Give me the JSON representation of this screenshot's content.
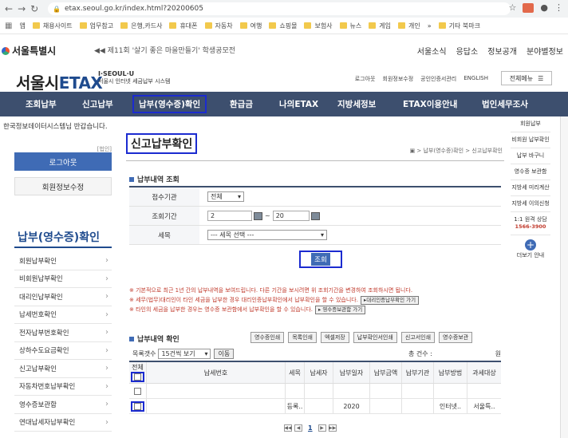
{
  "browser": {
    "url": "etax.seoul.go.kr/index.html?20200605",
    "bookmarks": [
      "앱",
      "채용사이트",
      "업무참고",
      "은행,카드사",
      "휴대폰",
      "자동차",
      "여행",
      "쇼핑몰",
      "보험사",
      "뉴스",
      "게임",
      "개인",
      "기타 북마크"
    ],
    "more": "»"
  },
  "seoul": {
    "logo": "서울특별시",
    "notice": "◀◀ 제11회 '살기 좋은 마을만들기' 학생공모전",
    "links": [
      "서울소식",
      "응답소",
      "정보공개",
      "분야별정보"
    ]
  },
  "etax": {
    "logo_a": "서울시",
    "logo_b": "ETAX",
    "sub1": "I·SEOUL·U",
    "sub2": "서울시 인터넷 세금납부 시스템",
    "utils": [
      "로그아웃",
      "회원정보수정",
      "공인인증서관리",
      "ENGLISH"
    ],
    "fullmenu": "전체메뉴"
  },
  "gnb": [
    "조회납부",
    "신고납부",
    "납부(영수증)확인",
    "환급금",
    "나의ETAX",
    "지방세정보",
    "ETAX이용안내",
    "법인세무조사"
  ],
  "left": {
    "user_line": "한국정보데이터시스템님 반갑습니다.",
    "user_tag": "[법인]",
    "logout": "로그아웃",
    "member": "회원정보수정",
    "title": "납부(영수증)확인",
    "menu": [
      "회원납부확인",
      "비회원납부확인",
      "대리인납부확인",
      "납세번호확인",
      "전자납부번호확인",
      "상하수도요금확인",
      "신고납부확인",
      "자동차번호납부확인",
      "영수증보관함",
      "연대납세자납부확인"
    ]
  },
  "main": {
    "title": "신고납부확인",
    "breadcrumb": "▣ > 납부(영수증)확인 > 신고납부확인",
    "search_head": "납부내역 조회",
    "th_org": "점수기관",
    "org_value": "전체",
    "th_period": "조회기간",
    "date_from": "2",
    "tilde": "~",
    "date_to": "20",
    "th_tax": "세목",
    "tax_value": "--- 세목 선택 ---",
    "search_btn": "조회",
    "notes": [
      "※ 기본적으로 최근 1년 간의 납부내역을 보여드립니다. 다른 기간을 보시려면 위 조회기간을 변경하여 조회하시면 됩니다.",
      "※ 세무(법무)대리인이 타인 세금을 납부한 경우 대리인증납부확인에서 납부확인을 할 수 있습니다.",
      "※ 타인의 세금을 납부한 경우는 영수증 보관함에서 납부확인을 할 수 있습니다."
    ],
    "note_btn1": "▸대리인증납부확인 가기",
    "note_btn2": "▸ 영수증보관함 가기",
    "result_head": "납부내역 확인",
    "toolbar": [
      "영수증인쇄",
      "목록인쇄",
      "엑셀저장",
      "납부확인서인쇄",
      "신고서인쇄",
      "영수증보관"
    ],
    "rows_label": "목록갯수",
    "rows_select": "15건씩 보기",
    "go": "이동",
    "total_label": "총 건수 :",
    "total_unit": "원",
    "cols": [
      "전체",
      "납세번호",
      "세목",
      "납세자",
      "납부일자",
      "납부금액",
      "납부기관",
      "납부방법",
      "과세대상"
    ],
    "rows": [
      [
        "",
        "",
        "",
        "",
        "",
        "",
        "",
        "",
        ""
      ],
      [
        "",
        "",
        "등록..",
        "",
        "2020",
        "",
        "",
        "인터넷..",
        "서울특.."
      ]
    ],
    "pager": {
      "first": "◀◀",
      "prev": "◀",
      "page": "1",
      "next": "▶",
      "last": "▶▶"
    }
  },
  "quick": [
    "회원납부",
    "비회원 납부확인",
    "납부 바구니",
    "영수증 보관함",
    "지방세 미리계산",
    "지방세 이의신청",
    "1:1 원격 상담",
    "더보기 안내"
  ],
  "quick_phone": "1566-3900",
  "quick_plus": "+"
}
